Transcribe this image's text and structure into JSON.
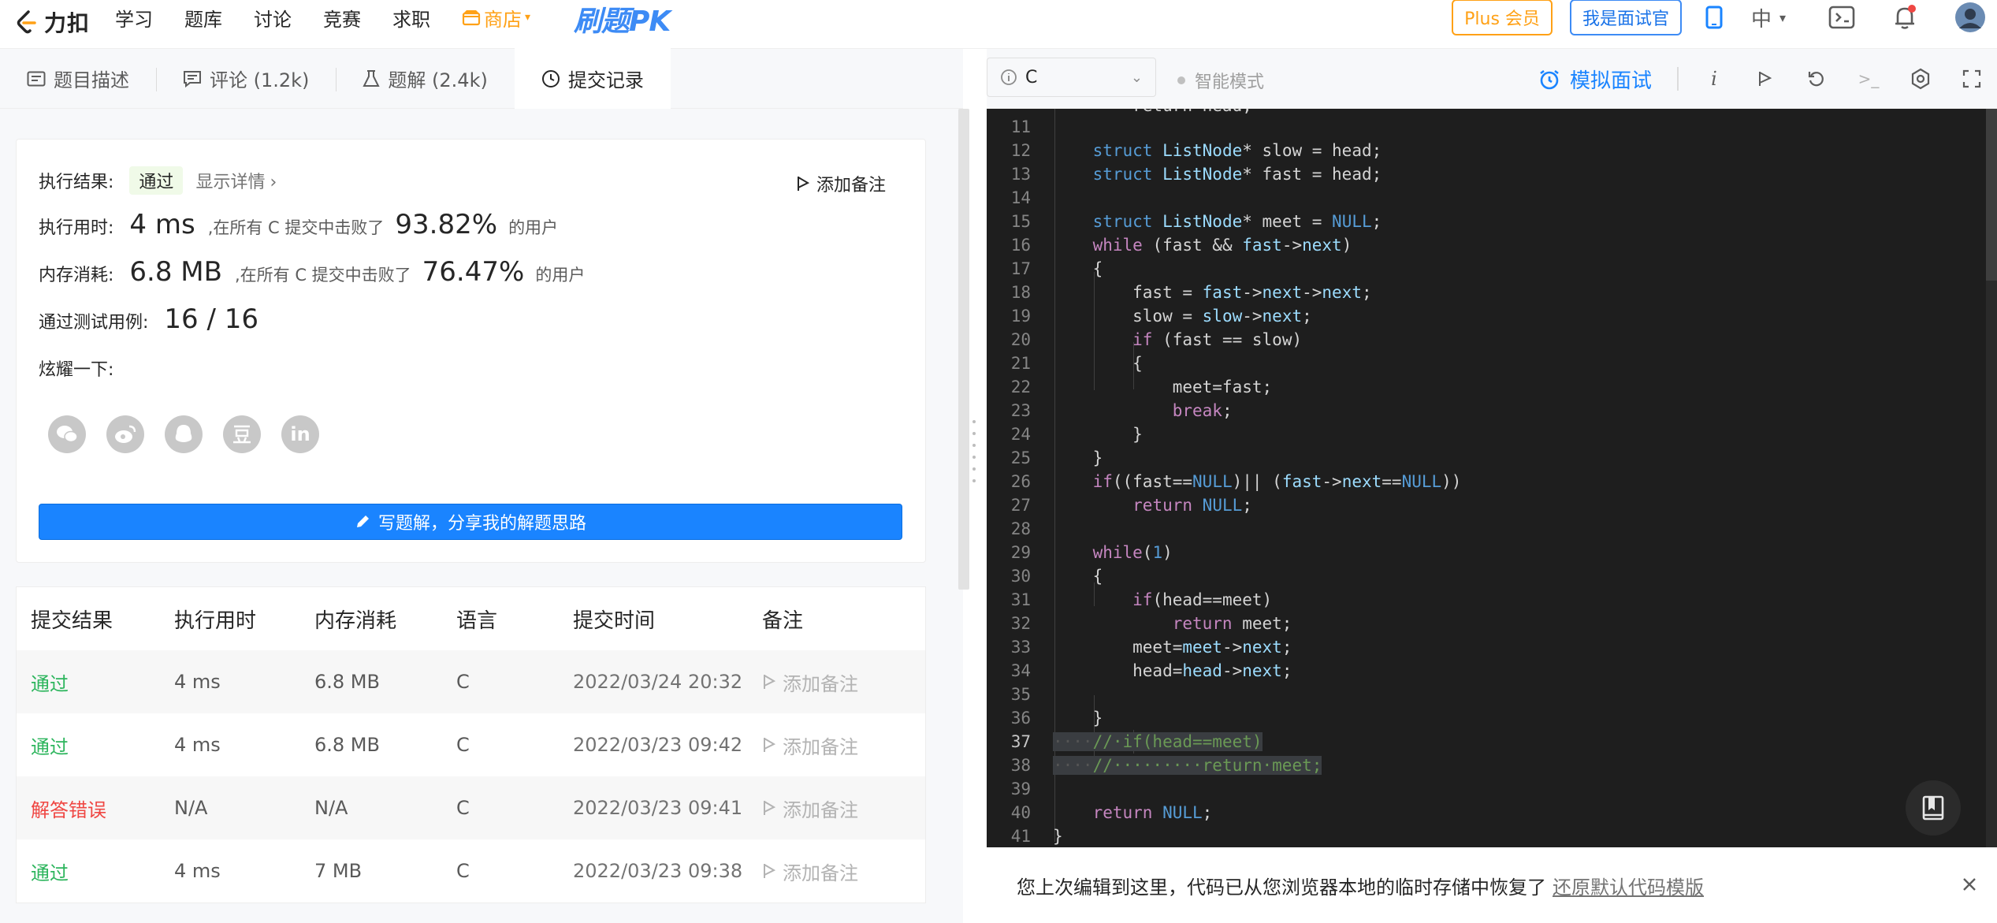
{
  "nav": {
    "logo_text": "力扣",
    "links": [
      "学习",
      "题库",
      "讨论",
      "竞赛",
      "求职"
    ],
    "store": "商店",
    "pk_text": "刷题PK",
    "plus_button": "Plus 会员",
    "interviewer_button": "我是面试官",
    "lang_switch": "中",
    "colors": {
      "accent": "#ffa116",
      "brand_blue": "#1a84ff"
    }
  },
  "tabs": [
    {
      "label": "题目描述",
      "icon": "description-icon"
    },
    {
      "label": "评论 (1.2k)",
      "icon": "comment-icon"
    },
    {
      "label": "题解 (2.4k)",
      "icon": "flask-icon"
    },
    {
      "label": "提交记录",
      "icon": "clock-icon",
      "active": true
    }
  ],
  "result": {
    "exec_label": "执行结果:",
    "exec_status": "通过",
    "show_detail": "显示详情",
    "add_note": "添加备注",
    "time_label": "执行用时:",
    "time_value": "4 ms",
    "time_mid": ",在所有 C 提交中击败了",
    "time_pct": "93.82%",
    "time_tail": "的用户",
    "mem_label": "内存消耗:",
    "mem_value": "6.8 MB",
    "mem_mid": ",在所有 C 提交中击败了",
    "mem_pct": "76.47%",
    "mem_tail": "的用户",
    "tests_label": "通过测试用例:",
    "tests_value": "16 / 16",
    "share_label": "炫耀一下:",
    "share_icons": [
      "wechat-icon",
      "weibo-icon",
      "qq-icon",
      "douban-icon",
      "linkedin-icon"
    ],
    "write_button": "写题解，分享我的解题思路"
  },
  "submissions": {
    "headers": [
      "提交结果",
      "执行用时",
      "内存消耗",
      "语言",
      "提交时间",
      "备注"
    ],
    "rows": [
      {
        "status": "通过",
        "ok": true,
        "time": "4 ms",
        "mem": "6.8 MB",
        "lang": "C",
        "date": "2022/03/24 20:32",
        "note": "添加备注"
      },
      {
        "status": "通过",
        "ok": true,
        "time": "4 ms",
        "mem": "6.8 MB",
        "lang": "C",
        "date": "2022/03/23 09:42",
        "note": "添加备注"
      },
      {
        "status": "解答错误",
        "ok": false,
        "time": "N/A",
        "mem": "N/A",
        "lang": "C",
        "date": "2022/03/23 09:41",
        "note": "添加备注"
      },
      {
        "status": "通过",
        "ok": true,
        "time": "4 ms",
        "mem": "7 MB",
        "lang": "C",
        "date": "2022/03/23 09:38",
        "note": "添加备注"
      }
    ]
  },
  "editor": {
    "language": "C",
    "smart_mode": "智能模式",
    "mock_interview": "模拟面试",
    "line_numbers": [
      "11",
      "12",
      "13",
      "14",
      "15",
      "16",
      "17",
      "18",
      "19",
      "20",
      "21",
      "22",
      "23",
      "24",
      "25",
      "26",
      "27",
      "28",
      "29",
      "30",
      "31",
      "32",
      "33",
      "34",
      "35",
      "36",
      "37",
      "38",
      "39",
      "40",
      "41"
    ]
  },
  "restore": {
    "message": "您上次编辑到这里，代码已从您浏览器本地的临时存储中恢复了",
    "link": "还原默认代码模版"
  }
}
